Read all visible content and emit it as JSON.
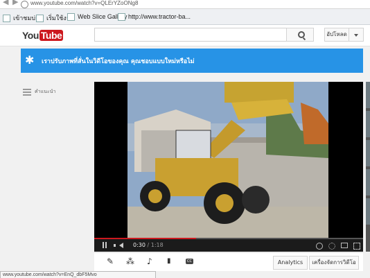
{
  "browser": {
    "url": "www.youtube.com/watch?v=QLErYZoONg8",
    "bookmarks": [
      "เข้าชมบ่อย",
      "เริ่มใช้งาน",
      "Web Slice Gallery",
      "http://www.tractor-ba..."
    ],
    "status_url": "www.youtube.com/watch?v=EnQ_dbF5Mvo"
  },
  "header": {
    "logo_you": "You",
    "logo_tube": "Tube",
    "search_placeholder": "",
    "upload_label": "อัปโหลด"
  },
  "banner": {
    "message": "เราปรับภาพที่สั่นในวิดีโอของคุณ คุณชอบแบบใหม่หรือไม่"
  },
  "guide": {
    "label": "คำแนะนำ"
  },
  "player": {
    "current_time": "0:30",
    "separator": " / ",
    "duration": "1:18",
    "progress_fraction": 0.38
  },
  "actions": {
    "cc_label": "CC",
    "analytics_label": "Analytics",
    "manager_label": "เครื่องจัดการวิดีโอ"
  },
  "colors": {
    "youtube_red": "#cc181e",
    "banner_blue": "#2793e6"
  },
  "icons": [
    "search-icon",
    "dropdown-icon",
    "star-icon",
    "guide-menu-icon",
    "play-pause-icon",
    "volume-icon",
    "settings-icon",
    "fullscreen-icon",
    "edit-icon",
    "enhance-icon",
    "music-icon",
    "annotation-icon",
    "captions-icon"
  ]
}
